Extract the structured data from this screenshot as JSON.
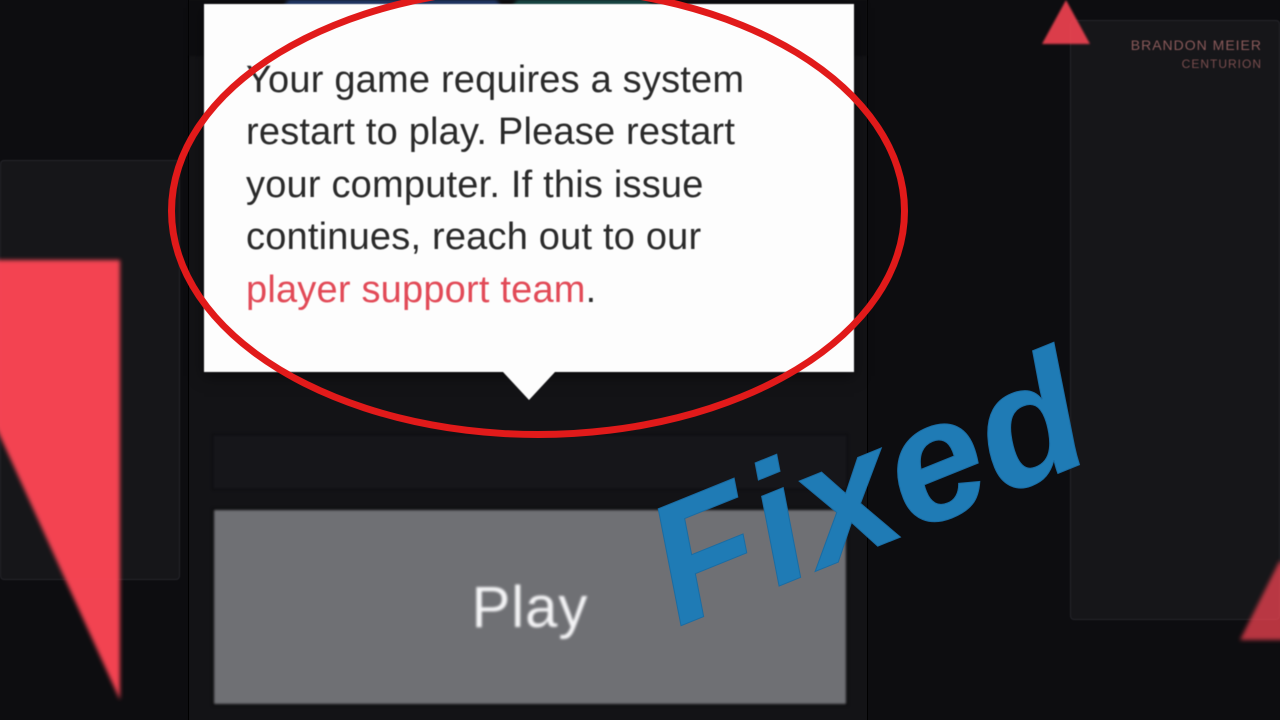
{
  "background": {
    "player_name": "BRANDON MEIER",
    "player_title": "CENTURION"
  },
  "tooltip": {
    "message_part1": "Your game requires a system restart to play. Please restart your computer. If this issue continues, reach out to our ",
    "link_text": "player support team",
    "message_part2": "."
  },
  "play_button": {
    "label": "Play"
  },
  "overlay": {
    "fixed_text": "Fixed"
  }
}
